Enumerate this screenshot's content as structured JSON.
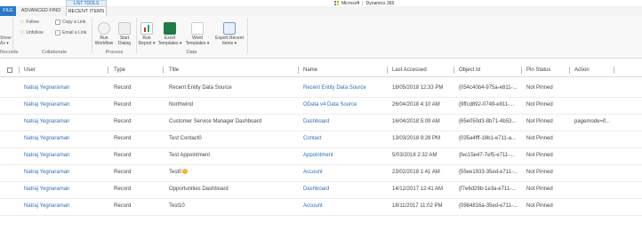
{
  "brand": {
    "name": "Microsoft",
    "product": "Dynamics 365"
  },
  "colors": {
    "accent": "#2b78c9",
    "link": "#2a6fc0"
  },
  "tabs": {
    "file": "FILE",
    "advanced_find": "ADVANCED FIND",
    "recent_items": "RECENT ITEMS",
    "context_label": "LIST TOOLS"
  },
  "ribbon": {
    "show_as": {
      "line1": "Show",
      "line2": "As ▾",
      "group": "Records"
    },
    "follow": "Follow",
    "unfollow": "Unfollow",
    "copy_link": "Copy a Link",
    "email_link": "Email a Link",
    "collaborate_label": "Collaborate",
    "run_workflow": {
      "line1": "Run",
      "line2": "Workflow"
    },
    "start_dialog": {
      "line1": "Start",
      "line2": "Dialog"
    },
    "process_label": "Process",
    "run_report": {
      "line1": "Run",
      "line2": "Report ▾"
    },
    "excel_templates": {
      "line1": "Excel",
      "line2": "Templates ▾"
    },
    "word_templates": {
      "line1": "Word",
      "line2": "Templates ▾"
    },
    "export_recent": {
      "line1": "Export Recent",
      "line2": "Items ▾"
    },
    "data_label": "Data"
  },
  "grid": {
    "headers": {
      "user": "User",
      "type": "Type",
      "title": "Title",
      "name": "Name",
      "last_accessed": "Last Accessed",
      "object_id": "Object Id",
      "pin_status": "Pin Status",
      "action": "Action"
    },
    "rows": [
      {
        "user": "Natraj Yegnaraman",
        "type": "Record",
        "title": "Recent Entity Data Source",
        "name": "Recent Entity Data Source",
        "last_accessed": "18/05/2018 12:33 PM",
        "object_id": "{054c40b4-975a-e811-...",
        "pin_status": "Not Pinned",
        "action": ""
      },
      {
        "user": "Natraj Yegnaraman",
        "type": "Record",
        "title": "Northwind",
        "name": "OData v4 Data Source",
        "last_accessed": "26/04/2018 4:10 AM",
        "object_id": "{9ffcd892-0749-e811-...",
        "pin_status": "Not Pinned",
        "action": ""
      },
      {
        "user": "Natraj Yegnaraman",
        "type": "Record",
        "title": "Customer Service Manager Dashboard",
        "name": "Dashboard",
        "last_accessed": "16/04/2018 5:09 AM",
        "object_id": "{65e050d3-8b71-4b53...",
        "pin_status": "Not Pinned",
        "action": "pagemode=if..."
      },
      {
        "user": "Natraj Yegnaraman",
        "type": "Record",
        "title": "Test Contact0",
        "name": "Contact",
        "last_accessed": "13/03/2018 9:28 PM",
        "object_id": "{035a4fff-18b1-e711-a...",
        "pin_status": "Not Pinned",
        "action": ""
      },
      {
        "user": "Natraj Yegnaraman",
        "type": "Record",
        "title": "Test Appointment",
        "name": "Appointment",
        "last_accessed": "5/03/2018 2:32 AM",
        "object_id": "{fec15e47-7ef5-e711-...",
        "pin_status": "Not Pinned",
        "action": ""
      },
      {
        "user": "Natraj Yegnaraman",
        "type": "Record",
        "title": "Test0",
        "name": "Account",
        "last_accessed": "23/02/2018 1:41 AM",
        "object_id": "{55ee1933-35ed-e711-...",
        "pin_status": "Not Pinned",
        "action": ""
      },
      {
        "user": "Natraj Yegnaraman",
        "type": "Record",
        "title": "Opportunities Dashboard",
        "name": "Dashboard",
        "last_accessed": "14/12/2017 12:41 AM",
        "object_id": "{f7e6d29b-1e3a-e711-...",
        "pin_status": "Not Pinned",
        "action": ""
      },
      {
        "user": "Natraj Yegnaraman",
        "type": "Record",
        "title": "Test10",
        "name": "Account",
        "last_accessed": "18/11/2017 11:02 PM",
        "object_id": "{0984816a-35ed-e711-...",
        "pin_status": "Not Pinned",
        "action": ""
      }
    ]
  }
}
